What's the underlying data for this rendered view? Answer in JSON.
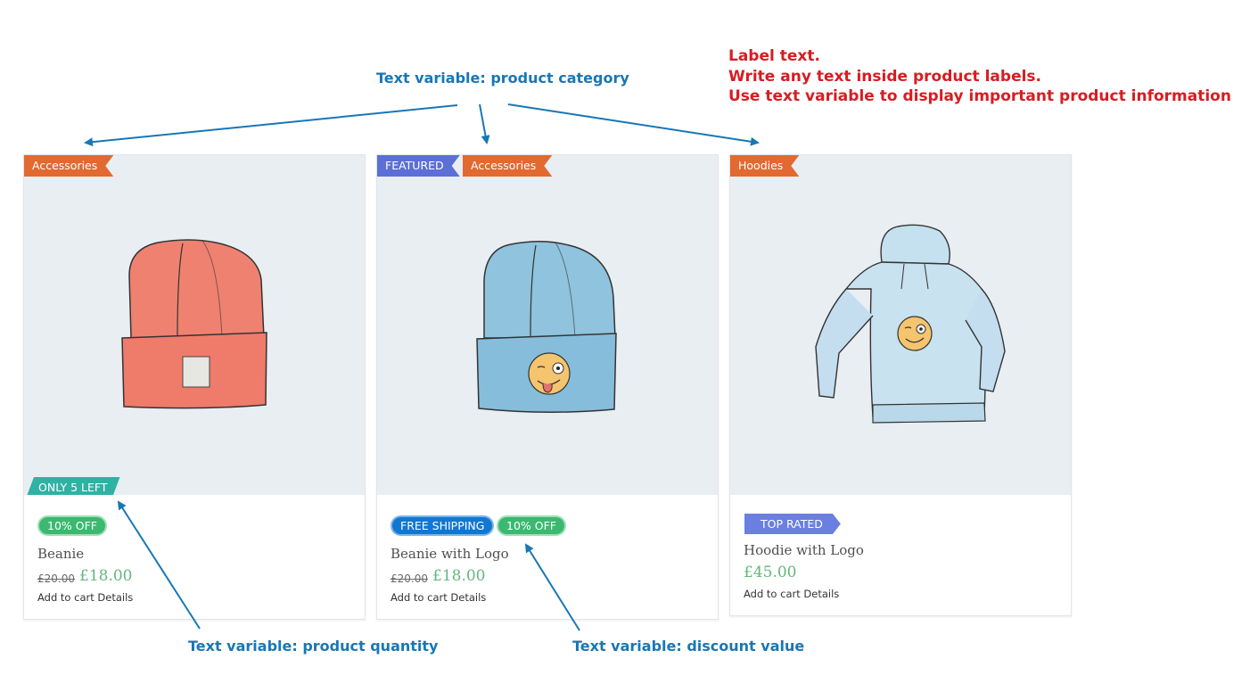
{
  "annotations": {
    "category": "Text variable: product category",
    "quantity": "Text variable: product quantity",
    "discount": "Text variable: discount value",
    "label_note": [
      "Label text.",
      "Write any text inside product labels.",
      "Use text variable to display important product information"
    ]
  },
  "colors": {
    "annotation_blue": "#1877b5",
    "annotation_red": "#d81c21",
    "label_orange": "#e2692f",
    "label_featured": "#5b6fd6",
    "label_teal": "#2fb2a4",
    "pill_green": "#3cb870",
    "pill_blue": "#1277d1",
    "label_top_rated": "#6b7fe0",
    "price_green": "#63b77a",
    "image_bg": "#e8eef2"
  },
  "products": [
    {
      "image": "red-beanie-illustration",
      "top_labels": [
        "Accessories"
      ],
      "image_label": "ONLY 5 LEFT",
      "badges": [
        "10% OFF"
      ],
      "title": "Beanie",
      "old_price": "£20.00",
      "price": "£18.00",
      "add_to_cart": "Add to cart",
      "details": "Details"
    },
    {
      "image": "blue-beanie-with-logo-illustration",
      "top_labels": [
        "FEATURED",
        "Accessories"
      ],
      "badges": [
        "FREE SHIPPING",
        "10% OFF"
      ],
      "title": "Beanie with Logo",
      "old_price": "£20.00",
      "price": "£18.00",
      "add_to_cart": "Add to cart",
      "details": "Details"
    },
    {
      "image": "hoodie-with-logo-illustration",
      "top_labels": [
        "Hoodies"
      ],
      "badges": [
        "TOP RATED"
      ],
      "title": "Hoodie with Logo",
      "price": "£45.00",
      "add_to_cart": "Add to cart",
      "details": "Details"
    }
  ]
}
